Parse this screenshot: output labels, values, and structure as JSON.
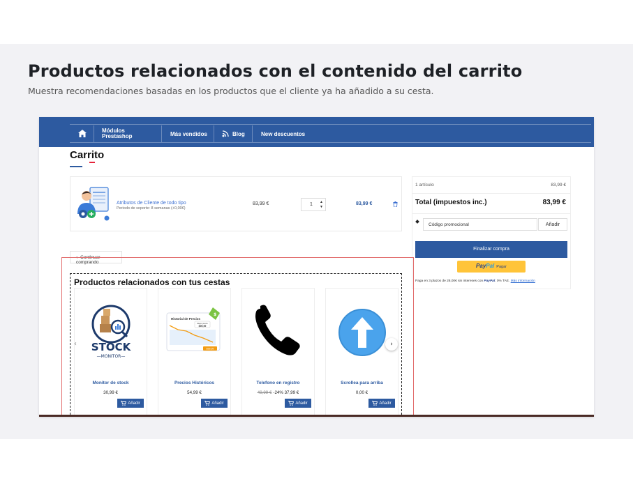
{
  "header": {
    "title": "Productos relacionados con el contenido del carrito",
    "subtitle": "Muestra recomendaciones basadas en los productos que el cliente ya ha añadido a su cesta."
  },
  "nav": {
    "home_icon": "home-icon",
    "modules_line1": "Módulos",
    "modules_line2": "Prestashop",
    "best_sellers": "Más vendidos",
    "blog": "Blog",
    "discounts": "New descuentos"
  },
  "cart": {
    "title": "Carrito",
    "item": {
      "name": "Atributos de Cliente de todo tipo",
      "subtitle": "Periodo de soporte: 8 semanas (+0,00€)",
      "unit_price": "83,99 €",
      "quantity": "1",
      "total": "83,99 €"
    },
    "continue_label": "Continuar comprando"
  },
  "summary": {
    "items_label": "1 artículo",
    "items_value": "83,99 €",
    "total_label": "Total (impuestos inc.)",
    "total_value": "83,99 €",
    "promo_placeholder": "Código promocional",
    "promo_button": "Añadir",
    "checkout_button": "Finalizar compra",
    "paypal_logo_a": "Pay",
    "paypal_logo_b": "Pal",
    "paypal_pagar": "Pagar",
    "paypal_note_prefix": "Paga en 3 plazos de 28,00€ sin intereses con",
    "paypal_note_brand": "PayPal",
    "paypal_note_suffix": ". 0% TAE.",
    "paypal_note_link": "Más información"
  },
  "related": {
    "title": "Productos relacionados con tus cestas",
    "products": [
      {
        "name": "Monitor de stock",
        "price": "30,99 €",
        "old_price": "",
        "button": "Añadir",
        "icon": "stock-monitor-icon",
        "logo_text": "STOCK",
        "logo_sub": "—MONITOR—"
      },
      {
        "name": "Precios Históricos",
        "price": "54,99 €",
        "old_price": "",
        "button": "Añadir",
        "icon": "price-history-icon",
        "chart_title": "Historial de Precios",
        "chart_tag": "$99,99",
        "chart_mejor": "Mejor precio",
        "chart_btn": "$99,99"
      },
      {
        "name": "Telefono en registro",
        "price": "-24% 37,99 €",
        "old_price": "49,99 €",
        "button": "Añadir",
        "icon": "phone-icon"
      },
      {
        "name": "Scrollea para arriba",
        "price": "0,00 €",
        "old_price": "",
        "button": "Añadir",
        "icon": "arrow-up-icon"
      }
    ],
    "prev_arrow": "‹",
    "next_arrow": "›"
  },
  "colors": {
    "nav_blue": "#2d5aa0",
    "accent_red": "#e5233a",
    "paypal_yellow": "#ffc439",
    "frame_red": "#e26d6d"
  }
}
